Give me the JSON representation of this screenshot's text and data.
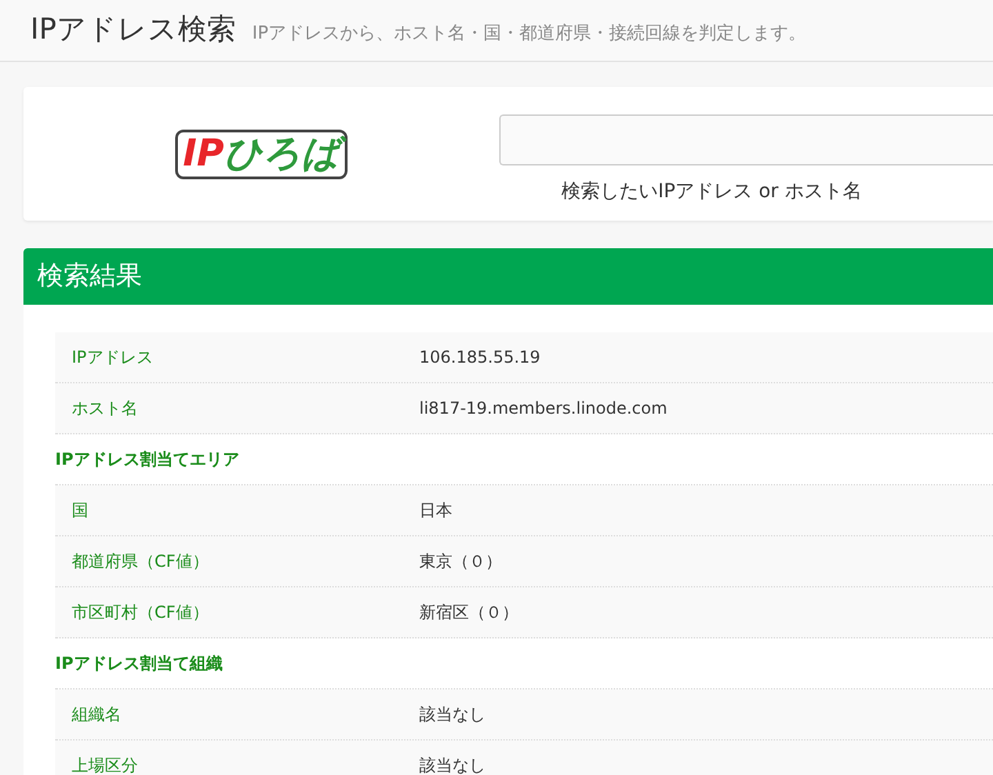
{
  "header": {
    "title": "IPアドレス検索",
    "subtitle": "IPアドレスから、ホスト名・国・都道府県・接続回線を判定します。"
  },
  "search": {
    "logo_parts": [
      "IP",
      "ひろば"
    ],
    "caption": "検索したいIPアドレス or ホスト名"
  },
  "results": {
    "title": "検索結果",
    "rows": [
      {
        "kind": "field",
        "label": "IPアドレス",
        "value": "106.185.55.19"
      },
      {
        "kind": "field",
        "label": "ホスト名",
        "value": "li817-19.members.linode.com"
      },
      {
        "kind": "section",
        "label": "IPアドレス割当てエリア"
      },
      {
        "kind": "field",
        "label": "国",
        "value": "日本"
      },
      {
        "kind": "field",
        "label": "都道府県（CF値）",
        "value": "東京（０）"
      },
      {
        "kind": "field",
        "label": "市区町村（CF値）",
        "value": "新宿区（０）"
      },
      {
        "kind": "section",
        "label": "IPアドレス割当て組織"
      },
      {
        "kind": "field",
        "label": "組織名",
        "value": "該当なし"
      },
      {
        "kind": "field",
        "label": "上場区分",
        "value": "該当なし"
      }
    ]
  }
}
